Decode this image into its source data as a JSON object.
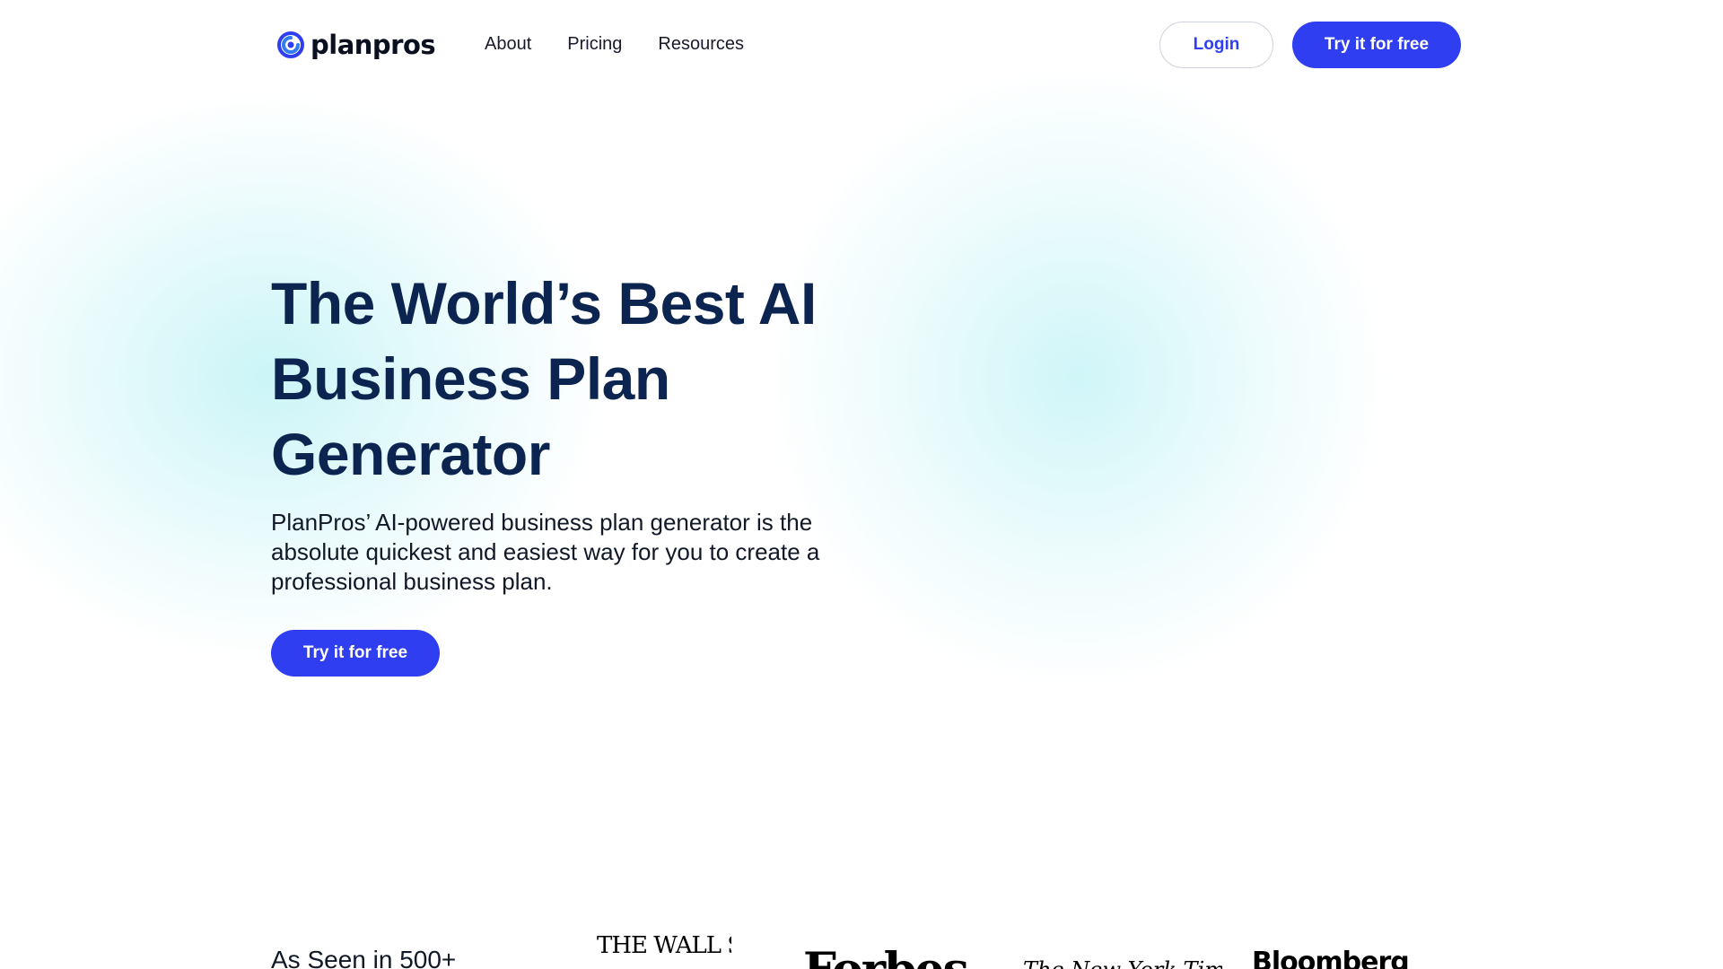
{
  "brand": {
    "name": "planpros",
    "accent_color": "#2f3ef0",
    "heading_color": "#0c2450",
    "logo_icon": "swirl-logo-icon"
  },
  "nav": {
    "items": [
      {
        "label": "About"
      },
      {
        "label": "Pricing"
      },
      {
        "label": "Resources"
      }
    ]
  },
  "header": {
    "login_label": "Login",
    "try_label": "Try it for free"
  },
  "hero": {
    "title": "The World’s Best AI Business Plan Generator",
    "subtitle": "PlanPros’ AI-powered business plan generator is the absolute quickest and easiest way for you to create a professional business plan.",
    "cta_label": "Try it for free"
  },
  "press": {
    "heading": "As Seen in 500+",
    "logos": [
      {
        "name": "THE WALL STREET"
      },
      {
        "name": "Forbes"
      },
      {
        "name": "The New York Times"
      },
      {
        "name": "Bloomberg"
      }
    ]
  }
}
